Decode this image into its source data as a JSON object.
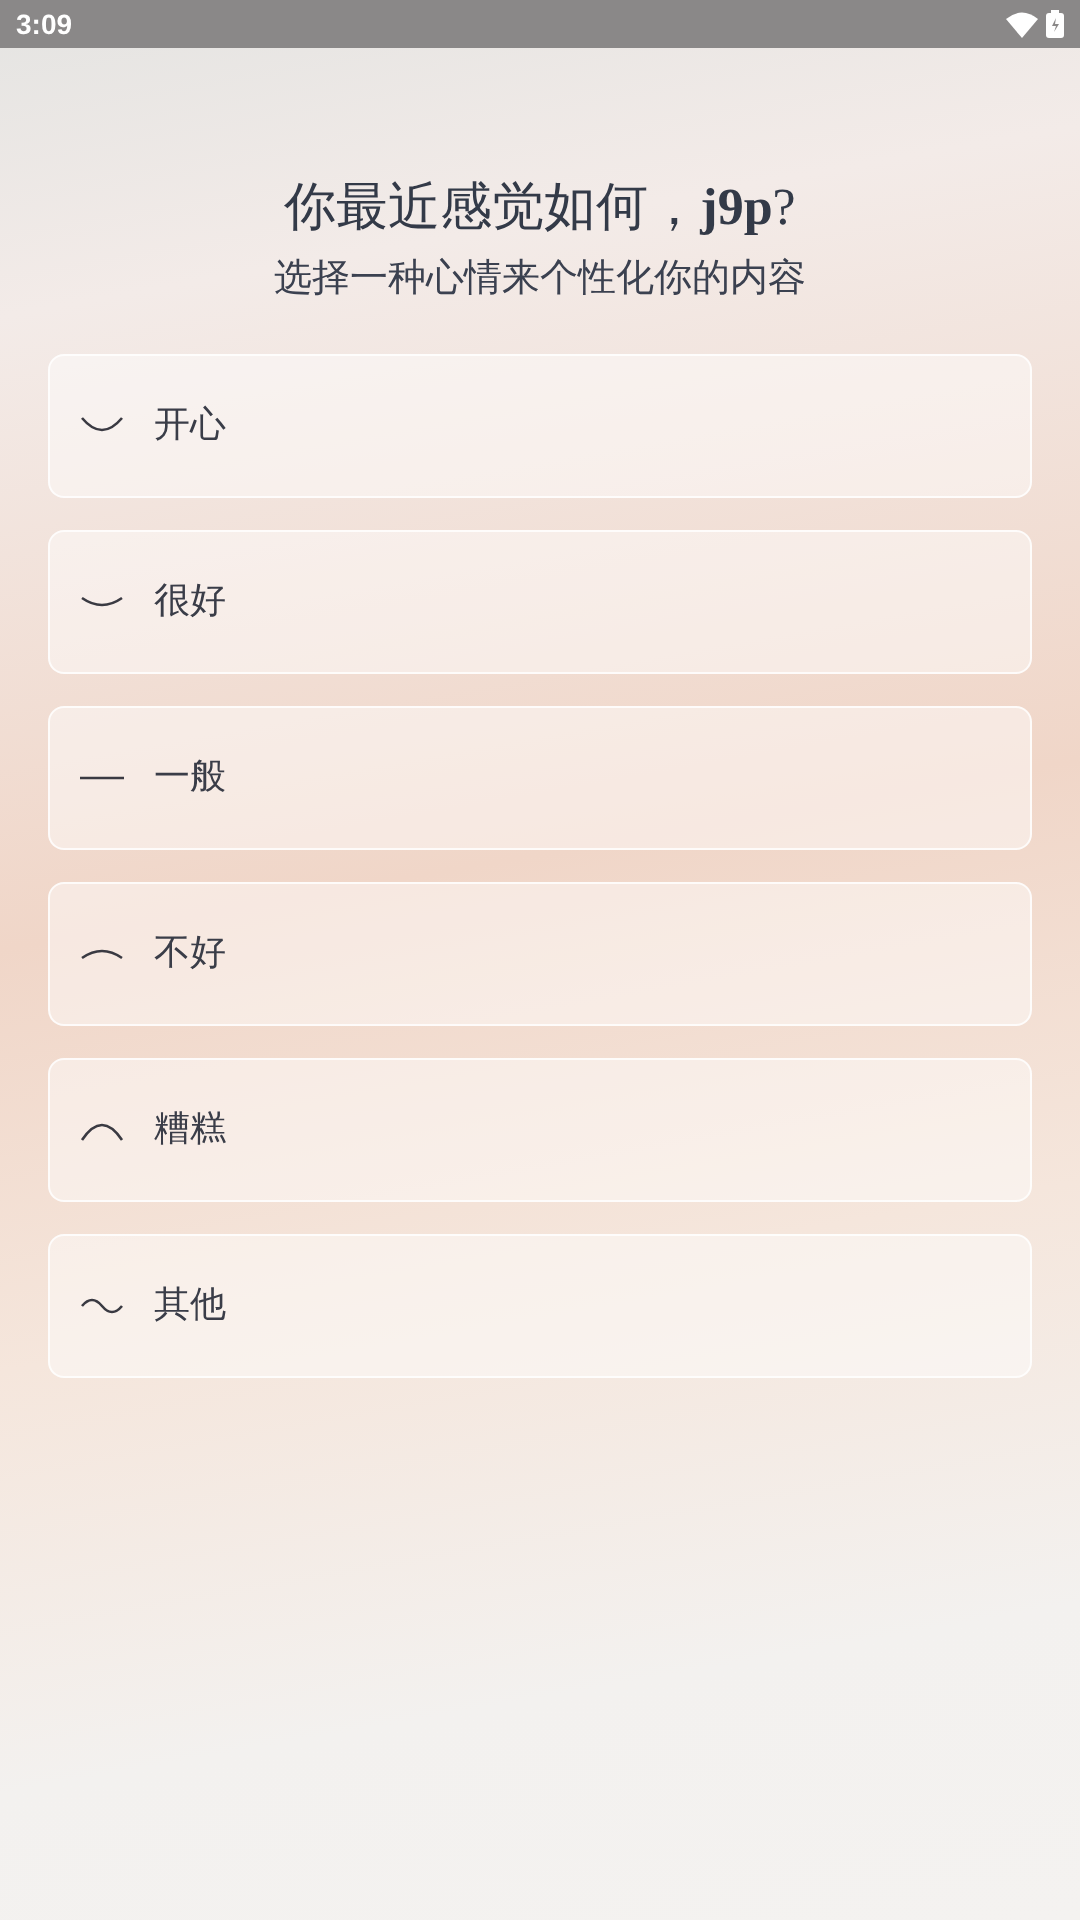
{
  "status_bar": {
    "time": "3:09"
  },
  "header": {
    "title": "你最近感觉如何，**j9p**?",
    "subtitle": "选择一种心情来个性化你的内容"
  },
  "moods": [
    {
      "label": "开心",
      "kind": "smile"
    },
    {
      "label": "很好",
      "kind": "slight-smile"
    },
    {
      "label": "一般",
      "kind": "flat"
    },
    {
      "label": "不好",
      "kind": "slight-frown"
    },
    {
      "label": "糟糕",
      "kind": "frown"
    },
    {
      "label": "其他",
      "kind": "wave"
    }
  ]
}
